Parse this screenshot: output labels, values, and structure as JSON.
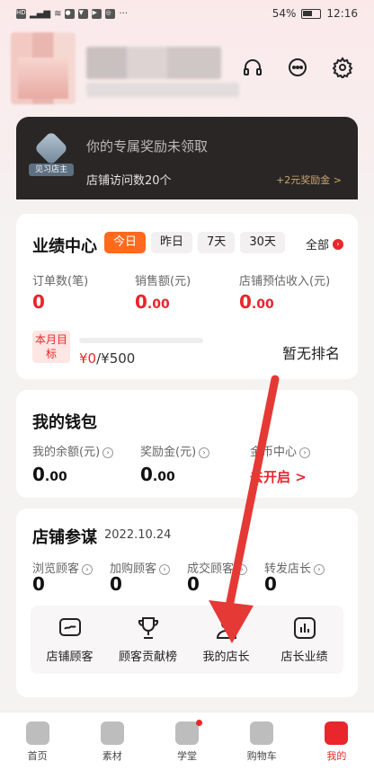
{
  "status_bar": {
    "battery": "54%",
    "time": "12:16"
  },
  "reward_banner": {
    "badge_label": "见习店主",
    "title": "你的专属奖励未领取",
    "subtitle": "店铺访问数20个",
    "right_text": "+2元奖励金 >"
  },
  "performance": {
    "title": "业绩中心",
    "tabs": [
      "今日",
      "昨日",
      "7天",
      "30天"
    ],
    "all_label": "全部",
    "stats": [
      {
        "label": "订单数(笔)",
        "value": "0",
        "decimal": ""
      },
      {
        "label": "销售额(元)",
        "value": "0",
        "decimal": ".00"
      },
      {
        "label": "店铺预估收入(元)",
        "value": "0",
        "decimal": ".00"
      }
    ],
    "month_tag": "本月目标",
    "target_current": "¥0",
    "target_total": "/¥500",
    "progress_fraction": 0,
    "rank_text": "暂无排名"
  },
  "wallet": {
    "title": "我的钱包",
    "items": [
      {
        "label": "我的余额(元)",
        "value": "0",
        "decimal": ".00"
      },
      {
        "label": "奖励金(元)",
        "value": "0",
        "decimal": ".00"
      },
      {
        "label": "金币中心",
        "action": "去开启 >"
      }
    ]
  },
  "store_advisor": {
    "title": "店铺参谋",
    "date": "2022.10.24",
    "stats": [
      {
        "label": "浏览顾客",
        "value": "0"
      },
      {
        "label": "加购顾客",
        "value": "0"
      },
      {
        "label": "成交顾客",
        "value": "0"
      },
      {
        "label": "转发店长",
        "value": "0"
      }
    ],
    "tools": [
      {
        "label": "店铺顾客",
        "icon": "customer-icon"
      },
      {
        "label": "顾客贡献榜",
        "icon": "trophy-icon"
      },
      {
        "label": "我的店长",
        "icon": "manager-icon"
      },
      {
        "label": "店长业绩",
        "icon": "chart-icon"
      }
    ]
  },
  "bottom_nav": [
    {
      "label": "首页",
      "icon": "home-icon"
    },
    {
      "label": "素材",
      "icon": "material-icon"
    },
    {
      "label": "学堂",
      "icon": "school-icon"
    },
    {
      "label": "购物车",
      "icon": "cart-icon"
    },
    {
      "label": "我的",
      "icon": "profile-icon"
    }
  ],
  "colors": {
    "accent": "#e8262b",
    "tab_active": "#ff6a1f",
    "banner": "#2a2626"
  }
}
